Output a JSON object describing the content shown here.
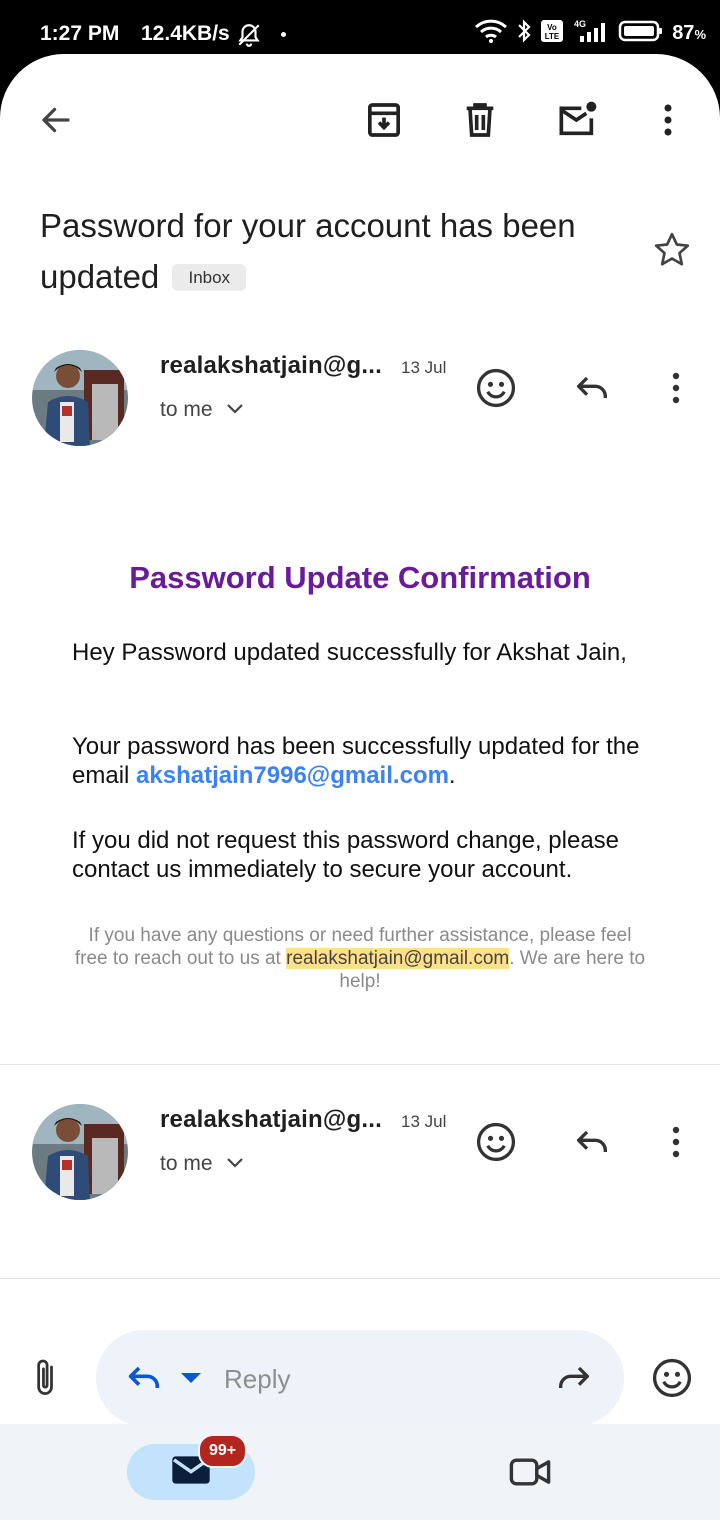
{
  "status_bar": {
    "time": "1:27 PM",
    "network_speed": "12.4KB/s",
    "battery_value": "87",
    "battery_unit": "%",
    "icons": [
      "bell-muted-icon",
      "wifi-icon",
      "bluetooth-icon",
      "volte-icon",
      "signal-4g-icon",
      "battery-icon"
    ]
  },
  "toolbar": {
    "icons": [
      "back-arrow-icon",
      "archive-icon",
      "delete-icon",
      "mark-unread-icon",
      "more-vert-icon"
    ]
  },
  "email": {
    "subject": "Password for your account has been updated",
    "label_chip": "Inbox"
  },
  "messages": [
    {
      "sender": "realakshatjain@g...",
      "date": "13 Jul",
      "recipient": "to me"
    },
    {
      "sender": "realakshatjain@g...",
      "date": "13 Jul",
      "recipient": "to me"
    }
  ],
  "body": {
    "heading": "Password Update Confirmation",
    "para1": "Hey Password updated successfully for Akshat Jain,",
    "para2_prefix": "Your password has been successfully updated for the email ",
    "para2_link": "akshatjain7996@gmail.com",
    "para2_suffix": ".",
    "para3": "If you did not request this password change, please contact us immediately to secure your account.",
    "footer_prefix": "If you have any questions or need further assistance, please feel free to reach out to us at ",
    "footer_email": "realakshatjain@gmail.com",
    "footer_suffix": ". We are here to help!"
  },
  "compose": {
    "reply_label": "Reply"
  },
  "bottom_nav": {
    "mail_badge": "99+"
  },
  "colors": {
    "heading_purple": "#6a1b9a",
    "link_blue": "#3b82f6",
    "highlight_yellow": "#ffe08a",
    "badge_red": "#b3261e",
    "reply_blue": "#0b57d0"
  }
}
